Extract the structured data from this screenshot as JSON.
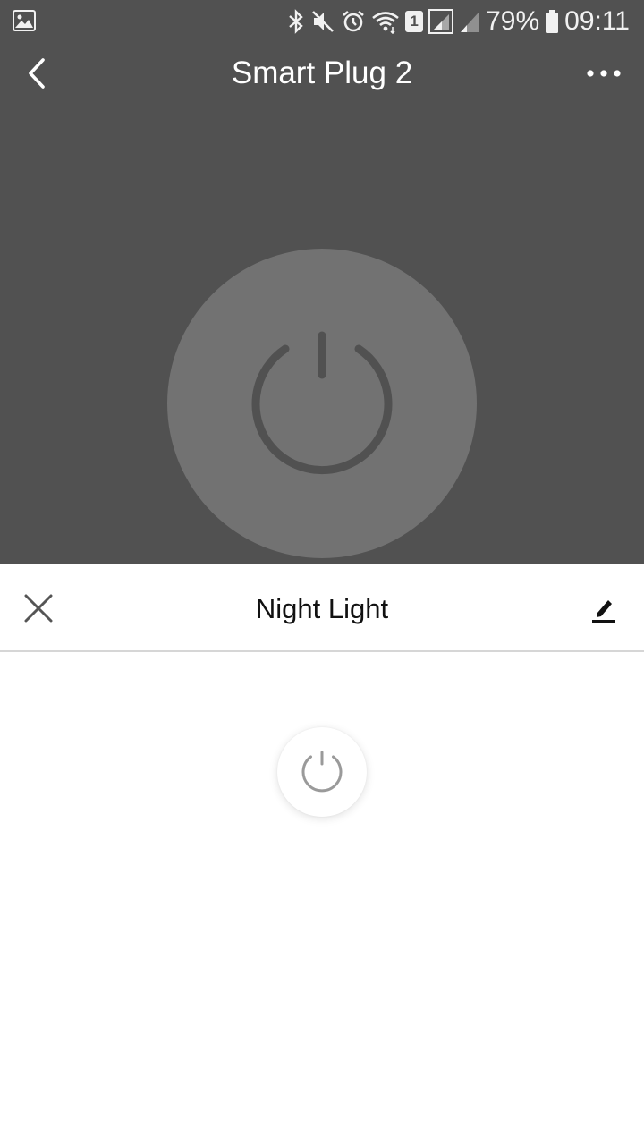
{
  "status_bar": {
    "battery": "79%",
    "time": "09:11",
    "sim": "1",
    "icons": [
      "gallery-icon",
      "bluetooth-icon",
      "mute-icon",
      "alarm-icon",
      "wifi-icon",
      "sim-icon",
      "signal-icon",
      "signal-weak-icon",
      "battery-icon"
    ]
  },
  "app_bar": {
    "title": "Smart Plug 2",
    "back_icon": "chevron-left-icon",
    "more_icon": "more-horizontal-icon"
  },
  "device": {
    "power_icon": "power-icon"
  },
  "sheet": {
    "title": "Night Light",
    "close_icon": "close-icon",
    "edit_icon": "pencil-icon",
    "power_icon": "power-icon"
  },
  "colors": {
    "top_background": "#515151",
    "power_circle": "#727272",
    "power_symbol": "#515151",
    "small_power_symbol": "#9a9a9a"
  }
}
